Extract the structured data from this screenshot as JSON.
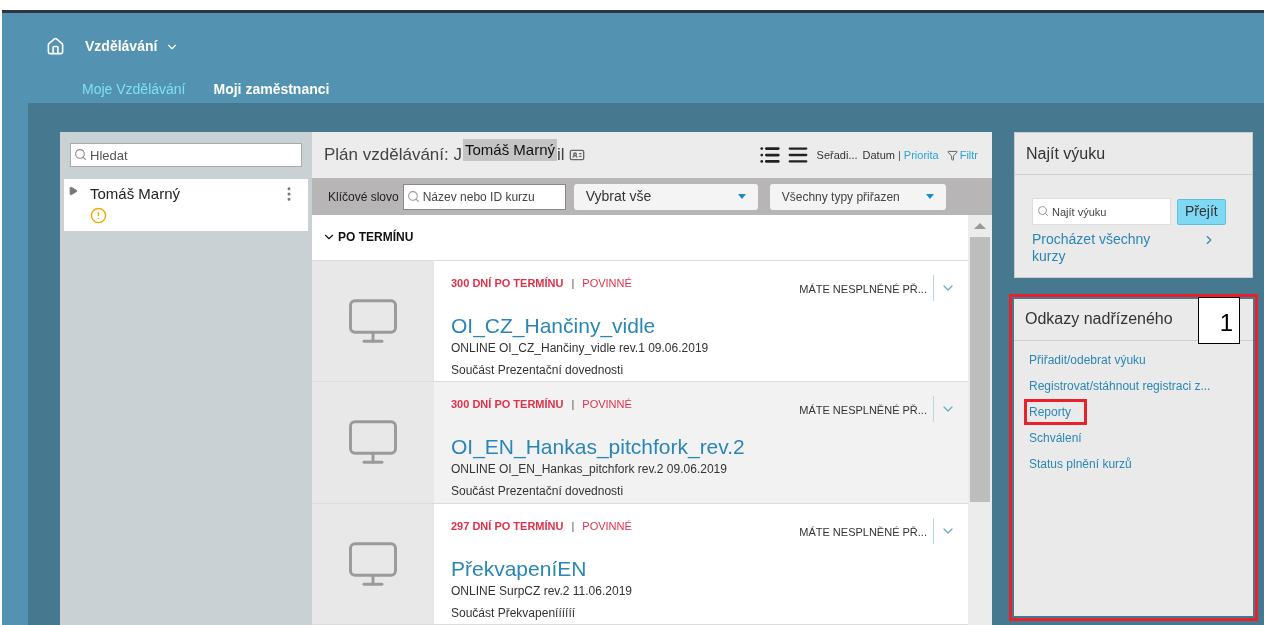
{
  "header": {
    "app_menu": "Vzdělávání"
  },
  "tabs": [
    {
      "label": "Moje Vzdělávání",
      "selected": false
    },
    {
      "label": "Moji zaměstnanci",
      "selected": true
    }
  ],
  "employees": {
    "search": {
      "placeholder": "Hledat"
    },
    "items": [
      {
        "name": "Tomáš Marný",
        "expanded": false,
        "warning": true
      }
    ]
  },
  "plan": {
    "title_prefix": "Plán vzdělávání: J",
    "title_overlay": "Tomáš Marný",
    "title_suffix": "il",
    "sort_label": "Seřadi...",
    "sort_separator": "|",
    "sort_options": [
      {
        "label": "Datum",
        "selected": false
      },
      {
        "label": "Priorita",
        "selected": true
      }
    ],
    "filter": "Filtr",
    "keyword_label": "Klíčové slovo",
    "keyword": {
      "placeholder": "Název nebo ID kurzu"
    },
    "select_1": "Vybrat vše",
    "select_2": "Všechny typy přiřazen",
    "section": "PO TERMÍNU",
    "courses": [
      {
        "overdue": "300 DNÍ PO TERMÍNU",
        "separator": "|",
        "required": "POVINNÉ",
        "status": "MÁTE NESPLNĚNÉ PŘ...",
        "title": "OI_CZ_Hančiny_vidle",
        "details": "ONLINE OI_CZ_Hančiny_vidle rev.1 09.06.2019",
        "part_of": "Součást Prezentační dovednosti",
        "highlighted": false
      },
      {
        "overdue": "300 DNÍ PO TERMÍNU",
        "separator": "|",
        "required": "POVINNÉ",
        "status": "MÁTE NESPLNĚNÉ PŘ...",
        "title": "OI_EN_Hankas_pitchfork_rev.2",
        "details": "ONLINE OI_EN_Hankas_pitchfork rev.2 09.06.2019",
        "part_of": "Součást Prezentační dovednosti",
        "highlighted": true
      },
      {
        "overdue": "297 DNÍ PO TERMÍNU",
        "separator": "|",
        "required": "POVINNÉ",
        "status": "MÁTE NESPLNĚNÉ PŘ...",
        "title": "PřekvapeníEN",
        "details": "ONLINE SurpCZ rev.2 11.06.2019",
        "part_of": "Součást Překvapeníííííí",
        "highlighted": false
      }
    ]
  },
  "find": {
    "title": "Najít výuku",
    "search": {
      "placeholder": "Najít výuku"
    },
    "button": "Přejít",
    "browse": "Procházet všechny kurzy"
  },
  "manager_links": {
    "title": "Odkazy nadřízeného",
    "callout": "1",
    "links": [
      {
        "label": "Přiřadit/odebrat výuku",
        "marked": false
      },
      {
        "label": "Registrovat/stáhnout registraci z...",
        "marked": false
      },
      {
        "label": "Reporty",
        "marked": true
      },
      {
        "label": "Schválení",
        "marked": false
      },
      {
        "label": "Status plnění kurzů",
        "marked": false
      }
    ]
  }
}
